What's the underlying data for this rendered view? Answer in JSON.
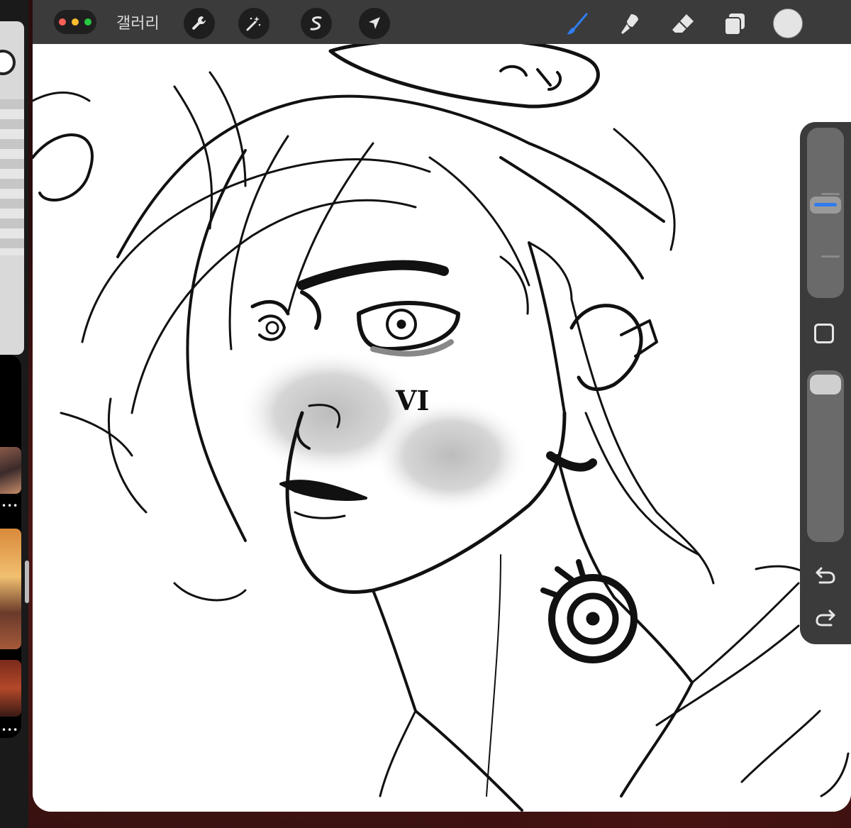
{
  "toolbar": {
    "gallery_label": "갤러리",
    "tools_left": [
      "wrench-icon",
      "magic-wand-icon",
      "selection-icon",
      "move-arrow-icon"
    ],
    "tools_right": [
      "brush-icon",
      "smudge-icon",
      "eraser-icon",
      "layers-icon"
    ],
    "active_tool": "brush-icon",
    "current_color": "#e4e4e4"
  },
  "traffic_lights": [
    "#ff5f57",
    "#febc2e",
    "#28c840"
  ],
  "sidebar": {
    "brush_size_level": 0.55,
    "opacity_level": 1.0
  },
  "colors": {
    "toolbar_bg": "#3b3b3b",
    "accent": "#2f7cf0",
    "canvas_bg": "#ffffff"
  },
  "canvas": {
    "text_marks": [
      "VI"
    ]
  }
}
